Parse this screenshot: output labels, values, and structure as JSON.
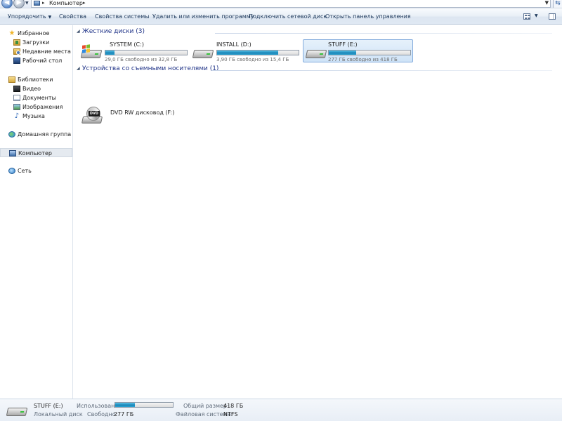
{
  "address_bar": {
    "crumb": "Компьютер",
    "separator": "▸"
  },
  "toolbar": {
    "organize": "Упорядочить",
    "properties": "Свойства",
    "system_properties": "Свойства системы",
    "uninstall": "Удалить или изменить программу",
    "map_drive": "Подключить сетевой диск",
    "control_panel": "Открыть панель управления"
  },
  "sidebar": {
    "items": [
      {
        "label": "Избранное",
        "icon": "star-icon"
      },
      {
        "label": "Загрузки",
        "icon": "downloads-icon"
      },
      {
        "label": "Недавние места",
        "icon": "recent-places-icon"
      },
      {
        "label": "Рабочий стол",
        "icon": "desktop-icon"
      },
      {
        "label": "Библиотеки",
        "icon": "libraries-icon"
      },
      {
        "label": "Видео",
        "icon": "video-icon"
      },
      {
        "label": "Документы",
        "icon": "documents-icon"
      },
      {
        "label": "Изображения",
        "icon": "pictures-icon"
      },
      {
        "label": "Музыка",
        "icon": "music-icon"
      },
      {
        "label": "Домашняя группа",
        "icon": "homegroup-icon"
      },
      {
        "label": "Компьютер",
        "icon": "computer-icon",
        "selected": true
      },
      {
        "label": "Сеть",
        "icon": "network-icon"
      }
    ]
  },
  "content": {
    "hard_drives_group": "Жесткие диски (3)",
    "removable_group": "Устройства со съемными носителями (1)",
    "drives": [
      {
        "name": "SYSTEM (C:)",
        "free": "29,0 ГБ свободно из 32,8 ГБ",
        "used_fraction": 0.116,
        "icon": "windows-drive-icon"
      },
      {
        "name": "INSTALL (D:)",
        "free": "3,90 ГБ свободно из 15,4 ГБ",
        "used_fraction": 0.747,
        "icon": "hard-drive-icon"
      },
      {
        "name": "STUFF (E:)",
        "free": "277 ГБ свободно из 418 ГБ",
        "used_fraction": 0.337,
        "icon": "hard-drive-icon",
        "selected": true
      }
    ],
    "dvd": {
      "name": "DVD RW дисковод (F:)",
      "badge": "DVD",
      "icon": "dvd-drive-icon"
    }
  },
  "details": {
    "name": "STUFF (E:)",
    "type": "Локальный диск",
    "used_label": "Использовано:",
    "used_fraction": 0.337,
    "free_label": "Свободно:",
    "free_value": "277 ГБ",
    "total_label": "Общий размер:",
    "total_value": "418 ГБ",
    "fs_label": "Файловая система:",
    "fs_value": "NTFS"
  },
  "colors": {
    "progress_bar": "#1b86b8",
    "group_title": "#1e3287",
    "selection": "#cfe3f7"
  }
}
